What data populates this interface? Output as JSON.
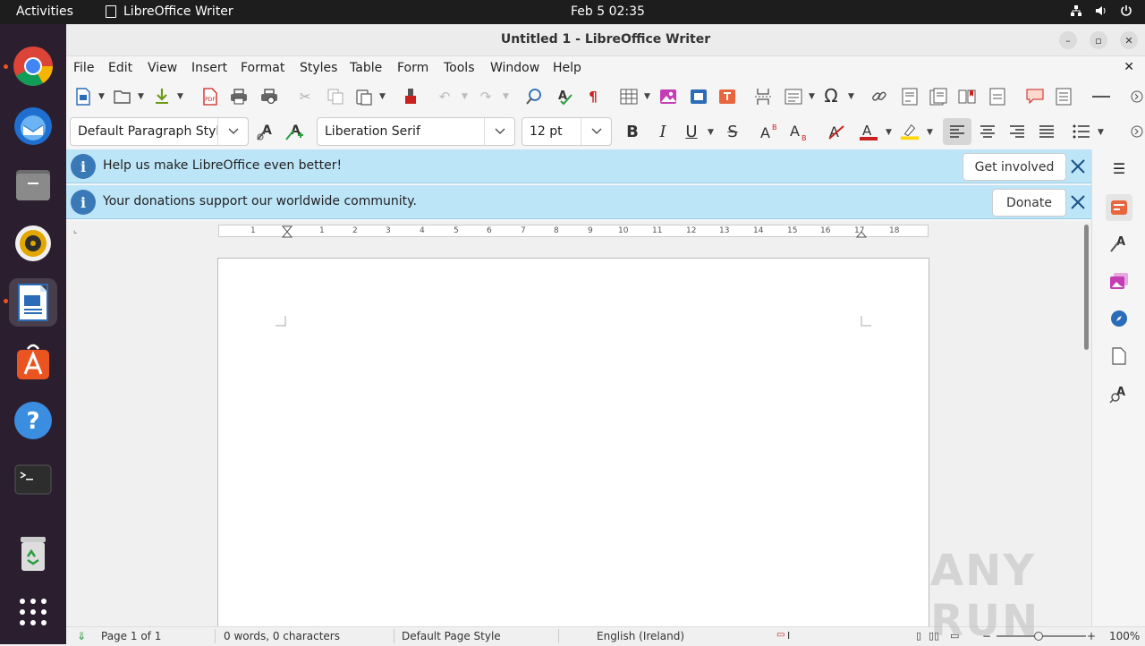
{
  "topbar": {
    "activities": "Activities",
    "app_name": "LibreOffice Writer",
    "clock": "Feb 5  02:35"
  },
  "dock": {
    "items": [
      "chrome-icon",
      "thunderbird-icon",
      "files-icon",
      "rhythmbox-icon",
      "libreoffice-writer-icon",
      "app-center-icon",
      "help-icon",
      "terminal-icon",
      "trash-icon",
      "show-apps-icon"
    ]
  },
  "window": {
    "title": "Untitled 1 - LibreOffice Writer"
  },
  "menubar": {
    "items": [
      "File",
      "Edit",
      "View",
      "Insert",
      "Format",
      "Styles",
      "Table",
      "Form",
      "Tools",
      "Window",
      "Help"
    ]
  },
  "formatting": {
    "paragraph_style": "Default Paragraph Styl",
    "font_name": "Liberation Serif",
    "font_size": "12 pt"
  },
  "infobars": [
    {
      "message": "Help us make LibreOffice even better!",
      "button": "Get involved"
    },
    {
      "message": "Your donations support our worldwide community.",
      "button": "Donate"
    }
  ],
  "ruler": {
    "numbers": [
      "1",
      "1",
      "2",
      "3",
      "4",
      "5",
      "6",
      "7",
      "8",
      "9",
      "10",
      "11",
      "12",
      "13",
      "14",
      "15",
      "16",
      "17",
      "18"
    ]
  },
  "statusbar": {
    "page": "Page 1 of 1",
    "word_count": "0 words, 0 characters",
    "page_style": "Default Page Style",
    "language": "English (Ireland)",
    "zoom": "100%"
  },
  "watermark": "ANY RUN",
  "colors": {
    "dock_bg": "#2b1f2f",
    "topbar_bg": "#1d1d1d",
    "infobar_bg": "#bde5f8",
    "font_color_red": "#c9211e",
    "highlight_yellow": "#ffd700"
  }
}
